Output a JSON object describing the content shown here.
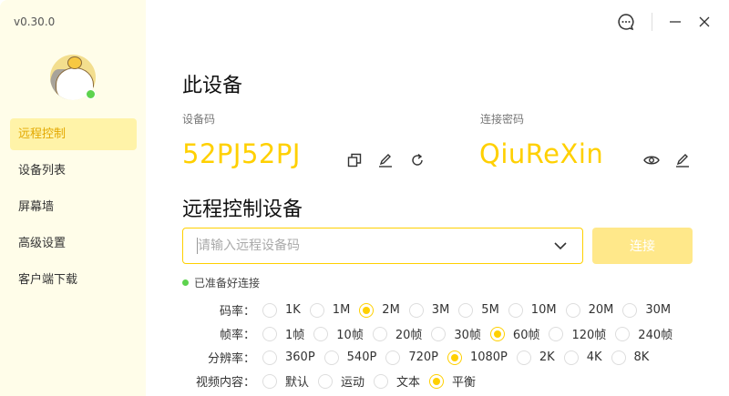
{
  "app": {
    "version": "v0.30.0"
  },
  "sidebar": {
    "items": [
      {
        "label": "远程控制",
        "active": true
      },
      {
        "label": "设备列表"
      },
      {
        "label": "屏幕墙"
      },
      {
        "label": "高级设置"
      },
      {
        "label": "客户端下载"
      }
    ]
  },
  "device": {
    "title": "此设备",
    "code_label": "设备码",
    "code": "52PJ52PJ",
    "password_label": "连接密码",
    "password": "QiuReXin"
  },
  "remote": {
    "title": "远程控制设备",
    "placeholder": "请输入远程设备码",
    "connect_label": "连接",
    "status": "已准备好连接"
  },
  "options": {
    "bitrate": {
      "label": "码率：",
      "items": [
        "1K",
        "1M",
        "2M",
        "3M",
        "5M",
        "10M",
        "20M",
        "30M"
      ],
      "selected": "2M"
    },
    "framerate": {
      "label": "帧率：",
      "items": [
        "1帧",
        "10帧",
        "20帧",
        "30帧",
        "60帧",
        "120帧",
        "240帧"
      ],
      "selected": "60帧"
    },
    "resolution": {
      "label": "分辨率：",
      "items": [
        "360P",
        "540P",
        "720P",
        "1080P",
        "2K",
        "4K",
        "8K"
      ],
      "selected": "1080P"
    },
    "content": {
      "label": "视频内容：",
      "items": [
        "默认",
        "运动",
        "文本",
        "平衡"
      ],
      "selected": "平衡"
    }
  },
  "colors": {
    "accent": "#FFD000",
    "sidebar": "#FFFDE9",
    "online": "#5DD34E"
  }
}
